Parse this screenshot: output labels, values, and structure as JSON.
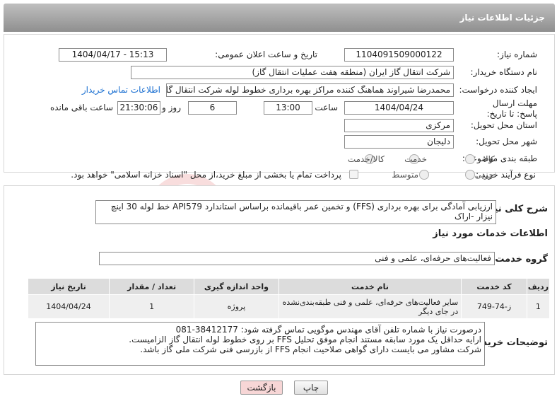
{
  "header": {
    "title": "جزئیات اطلاعات نیاز"
  },
  "fields": {
    "need_number_label": "شماره نیاز:",
    "need_number": "1104091509000122",
    "announce_label": "تاریخ و ساعت اعلان عمومی:",
    "announce_value": "1404/04/17 - 15:13",
    "buyer_org_label": "نام دستگاه خریدار:",
    "buyer_org": "شرکت انتقال گاز ایران (منطقه هفت عملیات انتقال گاز)",
    "creator_label": "ایجاد کننده درخواست:",
    "creator": "محمدرضا شیراوند هماهنگ کننده مراکز بهره برداری خطوط لوله  شرکت انتقال گا",
    "contact_link": "اطلاعات تماس خریدار",
    "deadline_label": "مهلت ارسال پاسخ: تا تاریخ:",
    "deadline_date": "1404/04/24",
    "time_label": "ساعت",
    "deadline_time": "13:00",
    "days": "6",
    "days_label": "روز و",
    "remaining": "21:30:06",
    "remaining_label": "ساعت باقی مانده",
    "province_label": "استان محل تحویل:",
    "province": "مرکزی",
    "city_label": "شهر محل تحویل:",
    "city": "دلیجان",
    "category_label": "طبقه بندی موضوعی:",
    "category_options": [
      "کالا",
      "خدمت",
      "کالا/خدمت"
    ],
    "process_label": "نوع فرآیند خرید :",
    "process_options": [
      "جزیی",
      "متوسط"
    ],
    "payment_note": "پرداخت تمام یا بخشی از مبلغ خرید،از محل \"اسناد خزانه اسلامی\" خواهد بود."
  },
  "general_desc": {
    "label": "شرح کلی نیاز:",
    "text_line1": "ارزیابی آمادگی برای بهره برداری (FFS) و تخمین عمر باقیمانده براساس استاندارد API579 خط لوله 30 اینچ",
    "text_line2": "نیزار -اراک"
  },
  "services": {
    "section_title": "اطلاعات خدمات مورد نیاز",
    "group_label": "گروه خدمت:",
    "group_value": "فعالیت‌های حرفه‌ای، علمی و فنی",
    "table": {
      "headers": [
        "ردیف",
        "کد خدمت",
        "نام خدمت",
        "واحد اندازه گیری",
        "تعداد / مقدار",
        "تاریخ نیاز"
      ],
      "rows": [
        [
          "1",
          "ز-74-749",
          "سایر فعالیت‌های حرفه‌ای، علمی و فنی طبقه‌بندی‌نشده در جای دیگر",
          "پروژه",
          "1",
          "1404/04/24"
        ]
      ]
    }
  },
  "buyer_notes": {
    "label": "توضیحات خریدار:",
    "line1": "درصورت نیاز با شماره تلفن آقای مهندس موگویی تماس گرفته شود: 38412177-081",
    "line2": "ارایه حداقل یک مورد سابقه مستند انجام موفق تحلیل FFS بر روی خطوط لوله انتقال گاز الزامیست.",
    "line3": "شرکت مشاور می بایست دارای گواهی صلاحیت انجام FFS از بازرسی فنی شرکت ملی گاز باشد."
  },
  "buttons": {
    "print": "چاپ",
    "back": "بازگشت"
  },
  "watermark": {
    "text": "AriaTender.neT"
  },
  "colors": {
    "link": "#1a6fd1",
    "header_bg": "#a6a6a6",
    "back_button_bg": "#f7d6d6"
  }
}
